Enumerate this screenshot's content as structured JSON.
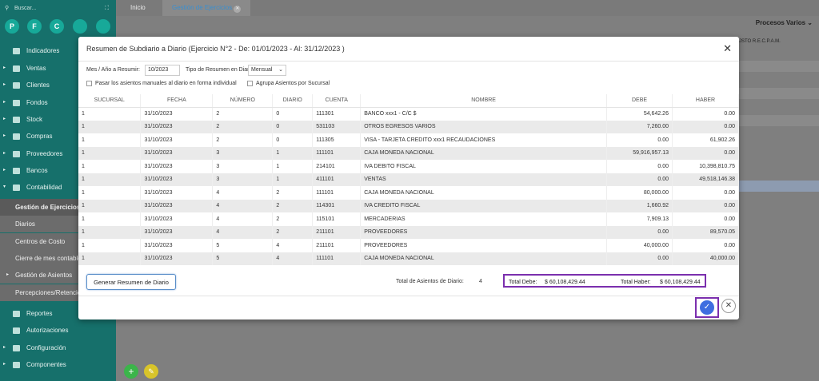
{
  "sidebar": {
    "search_placeholder": "Buscar...",
    "expand_icon": "⛶",
    "circles": [
      "P",
      "F",
      "C",
      "",
      ""
    ],
    "items": [
      {
        "label": "Indicadores",
        "arrow": ""
      },
      {
        "label": "Ventas",
        "arrow": "▸"
      },
      {
        "label": "Clientes",
        "arrow": "▸"
      },
      {
        "label": "Fondos",
        "arrow": "▸"
      },
      {
        "label": "Stock",
        "arrow": "▸"
      },
      {
        "label": "Compras",
        "arrow": "▸"
      },
      {
        "label": "Proveedores",
        "arrow": "▸"
      },
      {
        "label": "Bancos",
        "arrow": "▸"
      },
      {
        "label": "Contabilidad",
        "arrow": "▾"
      }
    ],
    "sub_items": [
      "Gestión de Ejercicios",
      "Diarios",
      "Centros de Costo",
      "Cierre de mes contable",
      "Gestión de Asientos",
      "Percepciones/Retenciones"
    ],
    "bottom_items": [
      {
        "label": "Reportes",
        "arrow": ""
      },
      {
        "label": "Autorizaciones",
        "arrow": ""
      },
      {
        "label": "Configuración",
        "arrow": "▸"
      },
      {
        "label": "Componentes",
        "arrow": "▸"
      }
    ]
  },
  "tabs": {
    "home": "Inicio",
    "active": "Gestión de Ejercicios",
    "close": "✕"
  },
  "procesos": "Procesos Varios",
  "bg_text": "JSTO R.E.C.P.A.M.",
  "modal": {
    "title": "Resumen de Subdiario a Diario (Ejercicio N°2 - De: 01/01/2023 - Al: 31/12/2023 )",
    "close": "✕",
    "mes_label": "Mes / Año a Resumir:",
    "mes_value": "10/2023",
    "tipo_label": "Tipo de Resumen en Diario:",
    "tipo_value": "Mensual",
    "chk1": "Pasar los asientos manuales al diario en forma individual",
    "chk2": "Agrupa Asientos por Sucursal",
    "columns": [
      "SUCURSAL",
      "FECHA",
      "NÚMERO",
      "DIARIO",
      "CUENTA",
      "NOMBRE",
      "DEBE",
      "HABER"
    ],
    "rows": [
      [
        "1",
        "31/10/2023",
        "2",
        "0",
        "111301",
        "BANCO xxx1 - C/C $",
        "54,642.26",
        "0.00"
      ],
      [
        "1",
        "31/10/2023",
        "2",
        "0",
        "531103",
        "OTROS EGRESOS VARIOS",
        "7,260.00",
        "0.00"
      ],
      [
        "1",
        "31/10/2023",
        "2",
        "0",
        "111305",
        "VISA - TARJETA CREDITO xxx1 RECAUDACIONES",
        "0.00",
        "61,902.26"
      ],
      [
        "1",
        "31/10/2023",
        "3",
        "1",
        "111101",
        "CAJA MONEDA NACIONAL",
        "59,916,957.13",
        "0.00"
      ],
      [
        "1",
        "31/10/2023",
        "3",
        "1",
        "214101",
        "IVA DEBITO FISCAL",
        "0.00",
        "10,398,810.75"
      ],
      [
        "1",
        "31/10/2023",
        "3",
        "1",
        "411101",
        "VENTAS",
        "0.00",
        "49,518,146.38"
      ],
      [
        "1",
        "31/10/2023",
        "4",
        "2",
        "111101",
        "CAJA MONEDA NACIONAL",
        "80,000.00",
        "0.00"
      ],
      [
        "1",
        "31/10/2023",
        "4",
        "2",
        "114301",
        "IVA CREDITO FISCAL",
        "1,660.92",
        "0.00"
      ],
      [
        "1",
        "31/10/2023",
        "4",
        "2",
        "115101",
        "MERCADERIAS",
        "7,909.13",
        "0.00"
      ],
      [
        "1",
        "31/10/2023",
        "4",
        "2",
        "211101",
        "PROVEEDORES",
        "0.00",
        "89,570.05"
      ],
      [
        "1",
        "31/10/2023",
        "5",
        "4",
        "211101",
        "PROVEEDORES",
        "40,000.00",
        "0.00"
      ],
      [
        "1",
        "31/10/2023",
        "5",
        "4",
        "111101",
        "CAJA MONEDA NACIONAL",
        "0.00",
        "40,000.00"
      ]
    ],
    "gen_button": "Generar Resumen de Diario",
    "total_asientos_label": "Total de Asientos de Diario:",
    "total_asientos": "4",
    "total_debe_label": "Total Debe:",
    "total_debe": "$ 60,108,429.44",
    "total_haber_label": "Total Haber:",
    "total_haber": "$ 60,108,429.44",
    "ok_icon": "✓",
    "cancel_icon": "✕"
  }
}
